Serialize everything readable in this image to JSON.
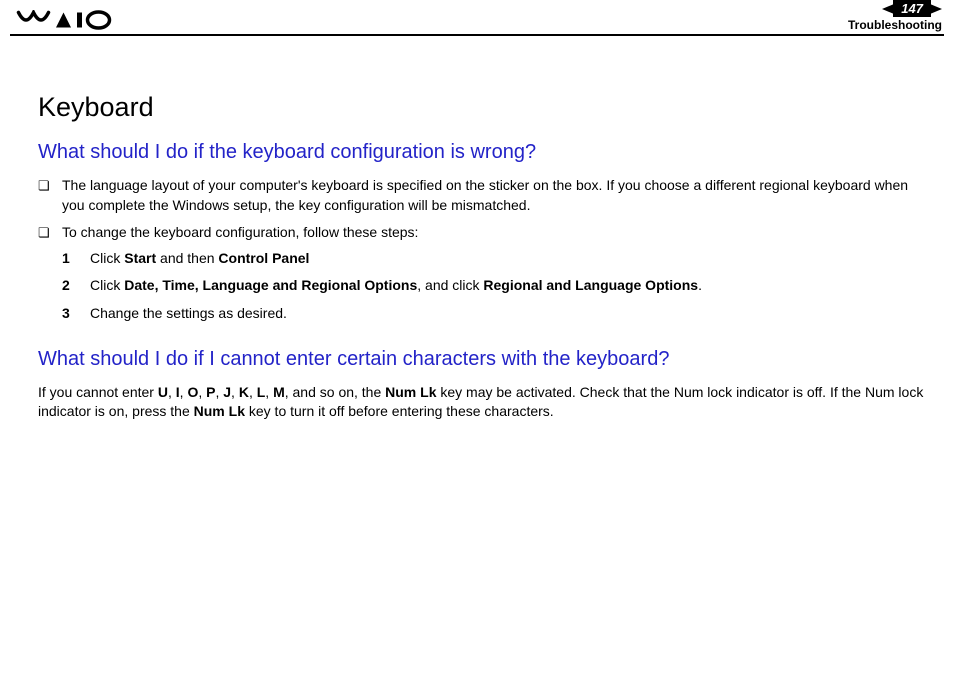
{
  "header": {
    "page_number": "147",
    "section_label": "Troubleshooting"
  },
  "page": {
    "title": "Keyboard",
    "section1": {
      "heading": "What should I do if the keyboard configuration is wrong?",
      "bullets": {
        "b1": "The language layout of your computer's keyboard is specified on the sticker on the box. If you choose a different regional keyboard when you complete the Windows setup, the key configuration will be mismatched.",
        "b2": "To change the keyboard configuration, follow these steps:"
      },
      "steps": {
        "s1": {
          "num": "1",
          "pre": "Click ",
          "bold1": "Start",
          "mid": " and then ",
          "bold2": "Control Panel"
        },
        "s2": {
          "num": "2",
          "pre": "Click ",
          "bold1": "Date, Time, Language and Regional Options",
          "mid": ", and click ",
          "bold2": "Regional and Language Options",
          "post": "."
        },
        "s3": {
          "num": "3",
          "text": "Change the settings as desired."
        }
      }
    },
    "section2": {
      "heading": "What should I do if I cannot enter certain characters with the keyboard?",
      "para": {
        "p1": "If you cannot enter ",
        "b1": "U",
        "c1": ", ",
        "b2": "I",
        "c2": ", ",
        "b3": "O",
        "c3": ", ",
        "b4": "P",
        "c4": ", ",
        "b5": "J",
        "c5": ", ",
        "b6": "K",
        "c6": ", ",
        "b7": "L",
        "c7": ", ",
        "b8": "M",
        "p2": ", and so on, the ",
        "b9": "Num Lk",
        "p3": " key may be activated. Check that the Num lock indicator is off. If the Num lock indicator is on, press the ",
        "b10": "Num Lk",
        "p4": " key to turn it off before entering these characters."
      }
    }
  }
}
